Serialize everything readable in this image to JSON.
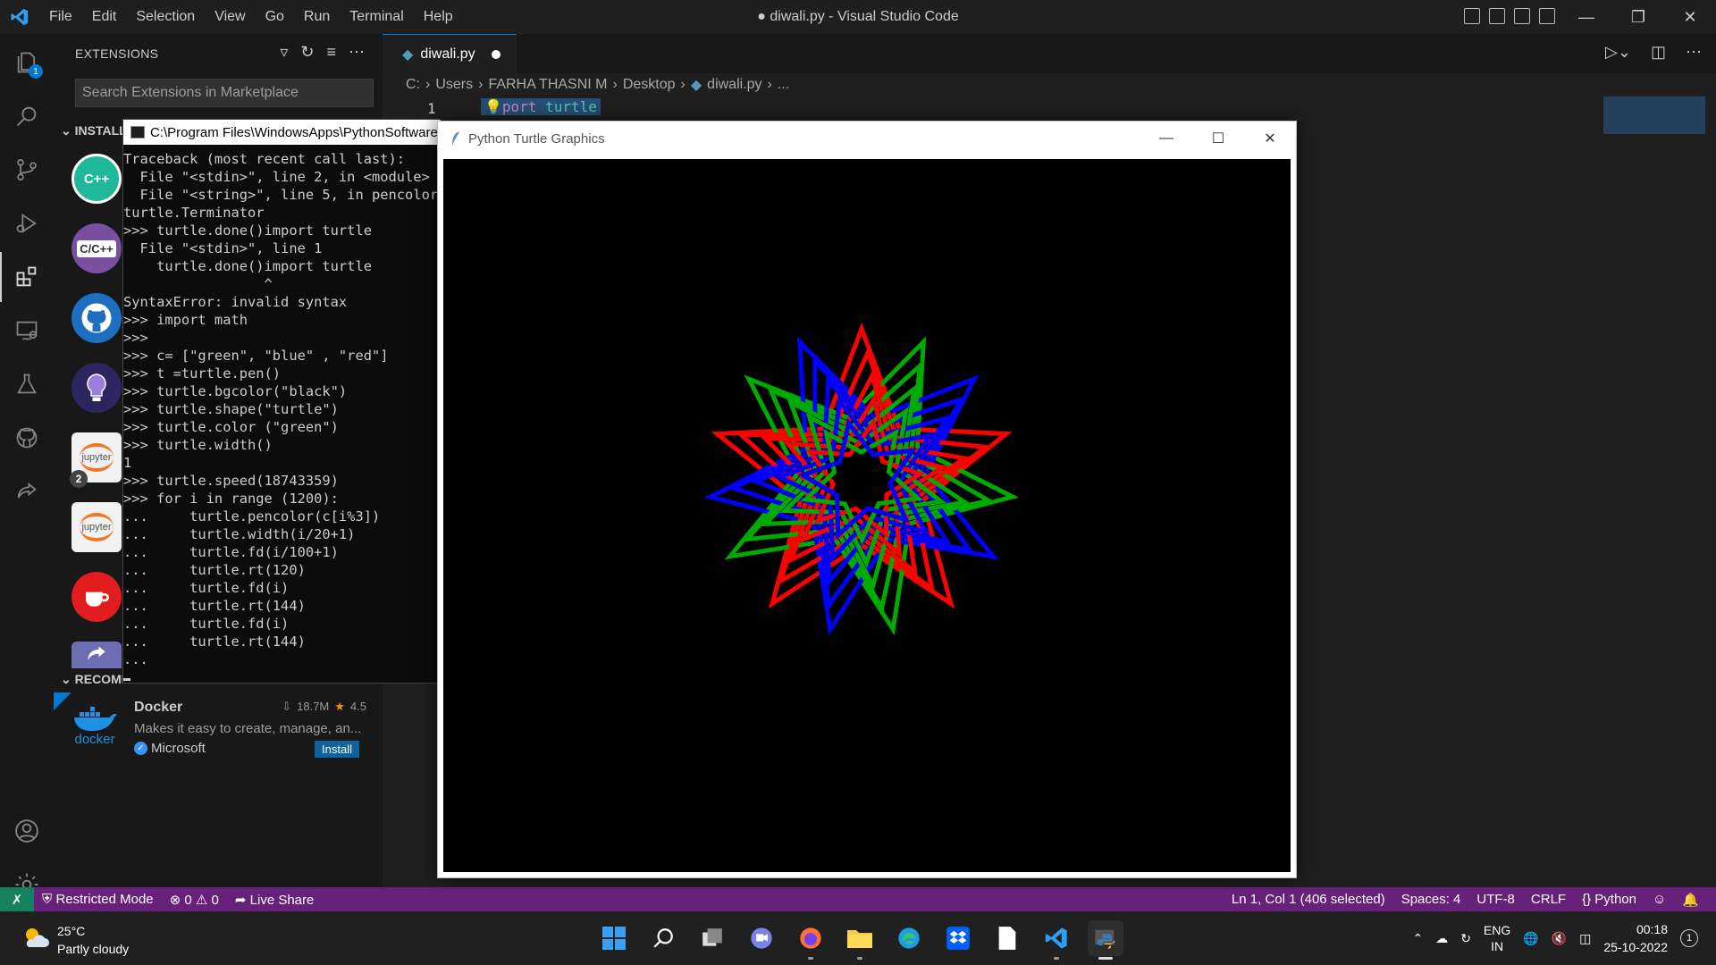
{
  "app": {
    "title": "● diwali.py - Visual Studio Code",
    "menu": [
      "File",
      "Edit",
      "Selection",
      "View",
      "Go",
      "Run",
      "Terminal",
      "Help"
    ]
  },
  "activitybar": {
    "explorer_badge": "1",
    "accent": "#0078d4"
  },
  "sidebar": {
    "header": "EXTENSIONS",
    "search_placeholder": "Search Extensions in Marketplace",
    "installed_label": "INSTALL",
    "recommended_label": "RECOMM",
    "installed": [
      {
        "name": "cpp-icon",
        "label": "C++",
        "color": "#1fb99a"
      },
      {
        "name": "cpp-ext-pack-icon",
        "label": "C/C++",
        "color": "#7a4fa0"
      },
      {
        "name": "github-icon",
        "label": "",
        "color": "#1e6fbf"
      },
      {
        "name": "lightbulb-icon",
        "label": "",
        "color": "#6e4ea8"
      },
      {
        "name": "jupyter-icon",
        "label": "jupyter",
        "badge": "2",
        "color": "#f37626"
      },
      {
        "name": "jupyter-keymap-icon",
        "label": "jupyter",
        "color": "#f37626"
      },
      {
        "name": "java-icon",
        "label": "",
        "color": "#e11d1d"
      },
      {
        "name": "share-icon",
        "label": "",
        "color": "#6d6db3"
      }
    ],
    "docker": {
      "name": "Docker",
      "downloads": "18.7M",
      "rating": "4.5",
      "description": "Makes it easy to create, manage, an...",
      "publisher": "Microsoft",
      "install_label": "Install",
      "logo_text": "docker"
    }
  },
  "editor": {
    "tab_label": "diwali.py",
    "breadcrumb": [
      "C:",
      "Users",
      "FARHA THASNI M",
      "Desktop",
      "diwali.py",
      "..."
    ],
    "line_number": "1",
    "code_keyword": "port",
    "code_rest": " turtle"
  },
  "console": {
    "title": "C:\\Program Files\\WindowsApps\\PythonSoftware",
    "lines": [
      "Traceback (most recent call last):",
      "  File \"<stdin>\", line 2, in <module>",
      "  File \"<string>\", line 5, in pencolor",
      "turtle.Terminator",
      ">>> turtle.done()import turtle",
      "  File \"<stdin>\", line 1",
      "    turtle.done()import turtle",
      "                 ^",
      "SyntaxError: invalid syntax",
      ">>> import math",
      ">>>",
      ">>> c= [\"green\", \"blue\" , \"red\"]",
      ">>> t =turtle.pen()",
      ">>> turtle.bgcolor(\"black\")",
      ">>> turtle.shape(\"turtle\")",
      ">>> turtle.color (\"green\")",
      ">>> turtle.width()",
      "1",
      ">>> turtle.speed(18743359)",
      ">>> for i in range (1200):",
      "...     turtle.pencolor(c[i%3])",
      "...     turtle.width(i/20+1)",
      "...     turtle.fd(i/100+1)",
      "...     turtle.rt(120)",
      "...     turtle.fd(i)",
      "...     turtle.rt(144)",
      "...     turtle.fd(i)",
      "...     turtle.rt(144)",
      "..."
    ]
  },
  "turtle_window": {
    "title": "Python Turtle Graphics",
    "colors": [
      "#00aa00",
      "#0000ff",
      "#ff0000"
    ],
    "background": "#000000"
  },
  "statusbar": {
    "restricted": "Restricted Mode",
    "errors": "0",
    "warnings": "0",
    "live_share": "Live Share",
    "position": "Ln 1, Col 1 (406 selected)",
    "spaces": "Spaces: 4",
    "encoding": "UTF-8",
    "eol": "CRLF",
    "language": "Python",
    "bg_color": "#68217a"
  },
  "taskbar": {
    "temperature": "25°C",
    "weather": "Partly cloudy",
    "lang1": "ENG",
    "lang2": "IN",
    "time": "00:18",
    "date": "25-10-2022",
    "notification_count": "1"
  }
}
